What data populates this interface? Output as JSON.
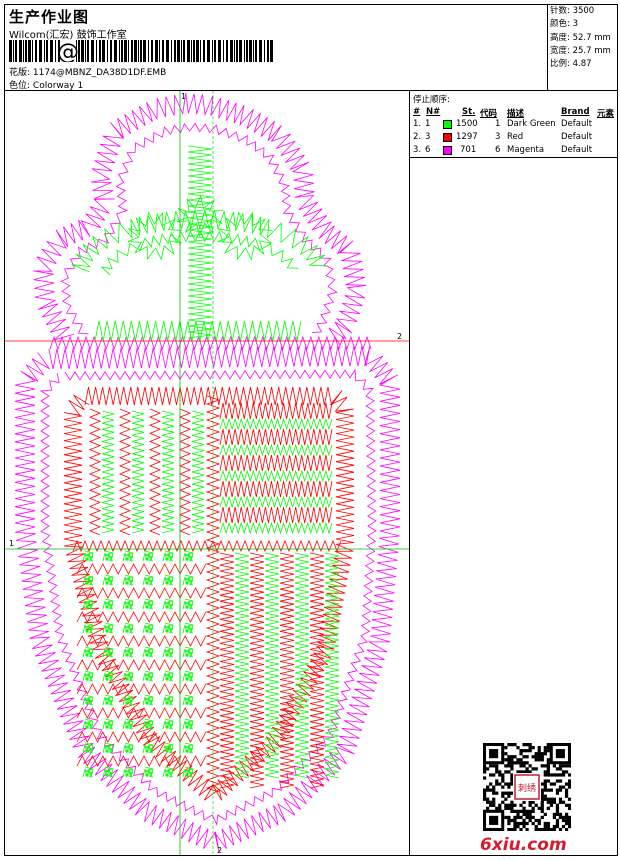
{
  "header": {
    "title": "生产作业图",
    "company": "Wilcom(汇宏) 鼓饰工作室",
    "design_label": "花版:",
    "design_value": "1174@MBNZ_DA38D1DF.EMB",
    "colorway_label": "色位:",
    "colorway_value": "Colorway 1"
  },
  "stats": [
    {
      "label": "针数:",
      "value": "3500"
    },
    {
      "label": "颜色:",
      "value": "3"
    },
    {
      "label": "高度:",
      "value": "52.7 mm"
    },
    {
      "label": "宽度:",
      "value": "25.7 mm"
    },
    {
      "label": "比例:",
      "value": "4.87"
    }
  ],
  "stop_sequence": {
    "heading": "停止顺序:",
    "columns": [
      "#",
      "N#",
      "St.",
      "代码",
      "描述",
      "Brand",
      "元素"
    ],
    "rows": [
      {
        "idx": "1.",
        "n": "1",
        "st": "1500",
        "code": "1",
        "desc": "Dark Green",
        "brand": "Default",
        "color": "#00ff00"
      },
      {
        "idx": "2.",
        "n": "3",
        "st": "1297",
        "code": "3",
        "desc": "Red",
        "brand": "Default",
        "color": "#ff0000"
      },
      {
        "idx": "3.",
        "n": "6",
        "st": "701",
        "code": "6",
        "desc": "Magenta",
        "brand": "Default",
        "color": "#ff00ff"
      }
    ]
  },
  "design_markers": {
    "m1_left": "1",
    "m1_top": "1",
    "m2_right": "2",
    "m2_bottom": "2"
  },
  "watermark": {
    "logo_text": "6xiu.com",
    "seal_text": "刺绣"
  },
  "colors": {
    "green": "#00ff00",
    "red": "#ff0000",
    "magenta": "#ff00ff",
    "crosshair": "#ff0000",
    "vguide": "#00cc00"
  }
}
